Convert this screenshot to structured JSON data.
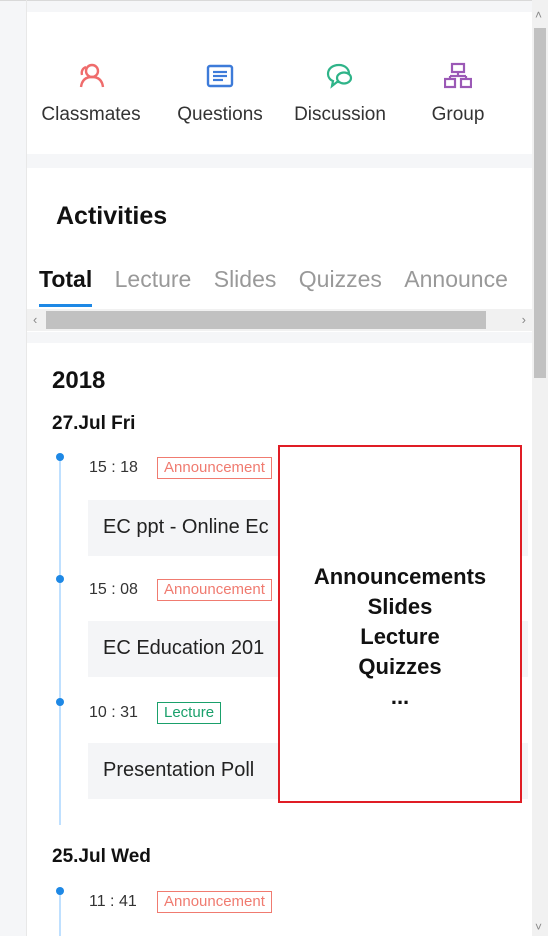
{
  "quick_actions": [
    {
      "label": "Classmates",
      "icon": "people-icon",
      "color": "#ef6c6c"
    },
    {
      "label": "Questions",
      "icon": "list-icon",
      "color": "#3d7bd9"
    },
    {
      "label": "Discussion",
      "icon": "chat-icon",
      "color": "#2fb489"
    },
    {
      "label": "Group",
      "icon": "hierarchy-icon",
      "color": "#9b59b6"
    }
  ],
  "activities": {
    "title": "Activities",
    "tabs": [
      "Total",
      "Lecture",
      "Slides",
      "Quizzes",
      "Announce"
    ]
  },
  "timeline": {
    "year": "2018",
    "days": [
      {
        "date": "27.Jul   Fri",
        "items": [
          {
            "time": "15 : 18",
            "tag": "Announcement",
            "title": "EC ppt - Online Ec"
          },
          {
            "time": "15 : 08",
            "tag": "Announcement",
            "title": "EC Education 201"
          },
          {
            "time": "10 : 31",
            "tag": "Lecture",
            "title": "Presentation Poll"
          }
        ]
      },
      {
        "date": "25.Jul   Wed",
        "items": [
          {
            "time": "11 : 41",
            "tag": "Announcement"
          }
        ]
      }
    ]
  },
  "overlay": {
    "lines": [
      "Announcements",
      "Slides",
      "Lecture",
      "Quizzes",
      "..."
    ]
  }
}
